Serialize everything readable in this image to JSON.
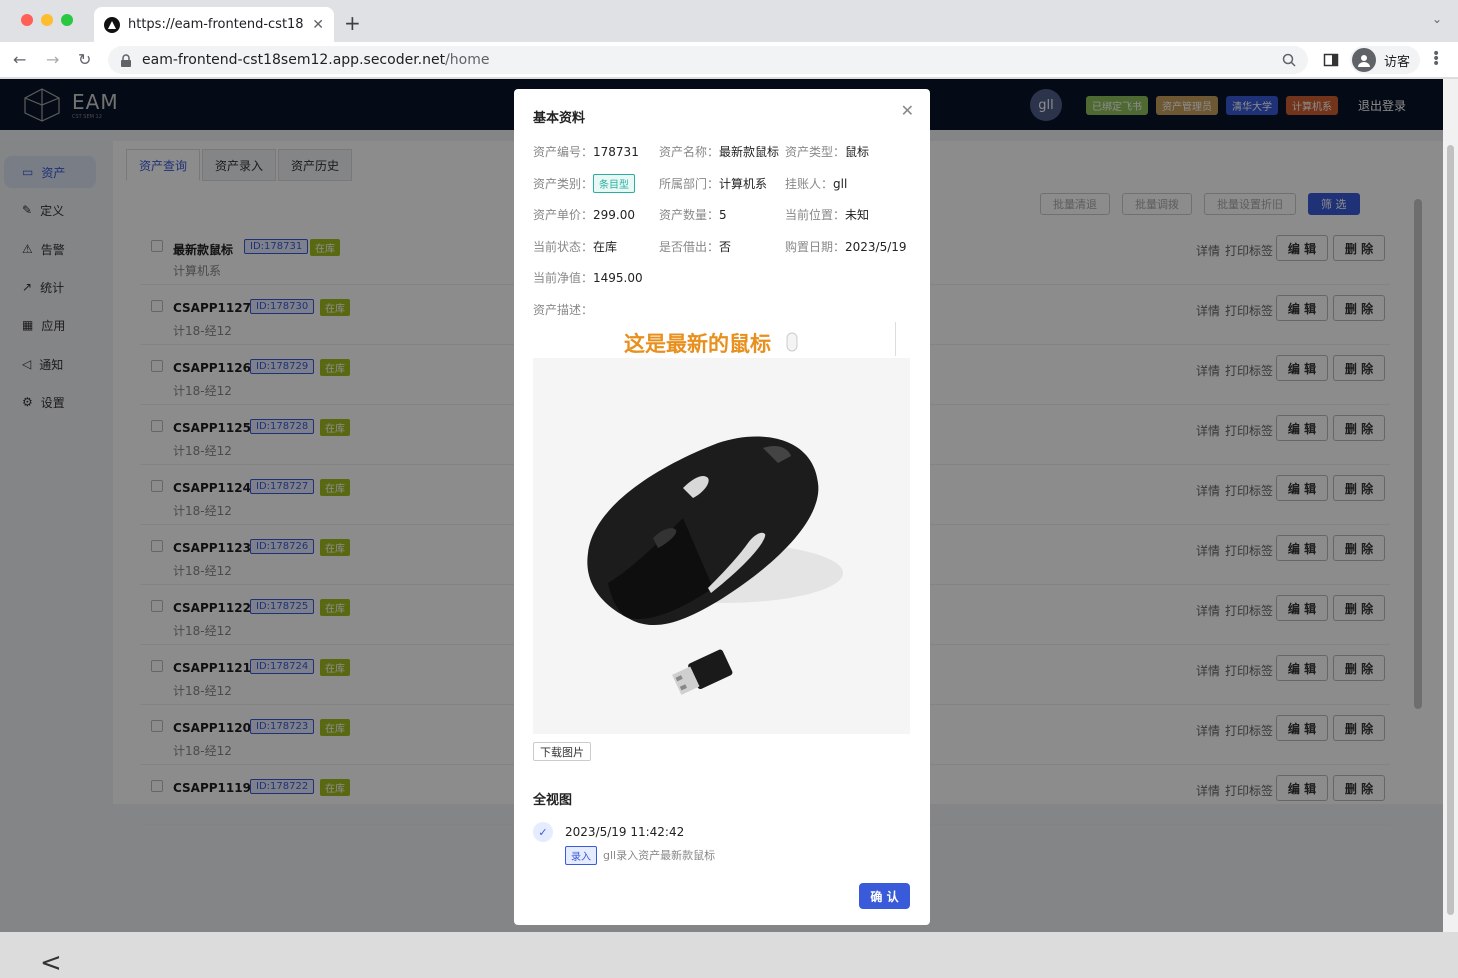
{
  "browser": {
    "tab_title": "https://eam-frontend-cst18sem12...",
    "url_host": "eam-frontend-cst18sem12.app.secoder.net",
    "url_path": "/home",
    "profile_label": "访客"
  },
  "header": {
    "logo_text": "EAM",
    "logo_sub": "CST SEM 12",
    "avatar": "gll",
    "badges": [
      {
        "label": "已绑定飞书",
        "color": "#8fbf5a"
      },
      {
        "label": "资产管理员",
        "color": "#c8a060"
      },
      {
        "label": "清华大学",
        "color": "#3a5bd9"
      },
      {
        "label": "计算机系",
        "color": "#d06030"
      }
    ],
    "logout": "退出登录"
  },
  "sidebar": {
    "items": [
      {
        "label": "资产",
        "icon": "monitor-icon"
      },
      {
        "label": "定义",
        "icon": "edit-icon"
      },
      {
        "label": "告警",
        "icon": "warning-icon"
      },
      {
        "label": "统计",
        "icon": "chart-icon"
      },
      {
        "label": "应用",
        "icon": "grid-icon"
      },
      {
        "label": "通知",
        "icon": "megaphone-icon"
      },
      {
        "label": "设置",
        "icon": "gear-icon"
      }
    ],
    "collapse": "<"
  },
  "content": {
    "tabs": [
      "资产查询",
      "资产录入",
      "资产历史"
    ],
    "actions": [
      "批量清退",
      "批量调拨",
      "批量设置折旧",
      "筛 选"
    ],
    "row_actions": {
      "detail": "详情",
      "print": "打印标签",
      "edit": "编 辑",
      "delete": "删 除"
    },
    "rows": [
      {
        "name": "最新款鼠标",
        "id": "ID:178731",
        "status": "在库",
        "dept": "计算机系"
      },
      {
        "name": "CSAPP1127",
        "id": "ID:178730",
        "status": "在库",
        "dept": "计18-经12"
      },
      {
        "name": "CSAPP1126",
        "id": "ID:178729",
        "status": "在库",
        "dept": "计18-经12"
      },
      {
        "name": "CSAPP1125",
        "id": "ID:178728",
        "status": "在库",
        "dept": "计18-经12"
      },
      {
        "name": "CSAPP1124",
        "id": "ID:178727",
        "status": "在库",
        "dept": "计18-经12"
      },
      {
        "name": "CSAPP1123",
        "id": "ID:178726",
        "status": "在库",
        "dept": "计18-经12"
      },
      {
        "name": "CSAPP1122",
        "id": "ID:178725",
        "status": "在库",
        "dept": "计18-经12"
      },
      {
        "name": "CSAPP1121",
        "id": "ID:178724",
        "status": "在库",
        "dept": "计18-经12"
      },
      {
        "name": "CSAPP1120",
        "id": "ID:178723",
        "status": "在库",
        "dept": "计18-经12"
      },
      {
        "name": "CSAPP1119",
        "id": "ID:178722",
        "status": "在库",
        "dept": ""
      }
    ]
  },
  "modal": {
    "title": "基本资料",
    "fields": {
      "asset_no": {
        "k": "资产编号：",
        "v": "178731"
      },
      "asset_name": {
        "k": "资产名称：",
        "v": "最新款鼠标"
      },
      "asset_type": {
        "k": "资产类型：",
        "v": "鼠标"
      },
      "asset_cat": {
        "k": "资产类别：",
        "v": "条目型"
      },
      "dept": {
        "k": "所属部门：",
        "v": "计算机系"
      },
      "owner": {
        "k": "挂账人：",
        "v": "gll"
      },
      "price": {
        "k": "资产单价：",
        "v": "299.00"
      },
      "qty": {
        "k": "资产数量：",
        "v": "5"
      },
      "location": {
        "k": "当前位置：",
        "v": "未知"
      },
      "status": {
        "k": "当前状态：",
        "v": "在库"
      },
      "borrowed": {
        "k": "是否借出：",
        "v": "否"
      },
      "buy_date": {
        "k": "购置日期：",
        "v": "2023/5/19"
      },
      "net_value": {
        "k": "当前净值：",
        "v": "1495.00"
      },
      "desc": {
        "k": "资产描述：",
        "v": ""
      }
    },
    "desc_heading": "这是最新的鼠标",
    "download": "下载图片",
    "overview_title": "全视图",
    "timeline": {
      "time": "2023/5/19 11:42:42",
      "tag": "录入",
      "text": "gll录入资产最新款鼠标"
    },
    "confirm": "确 认"
  }
}
